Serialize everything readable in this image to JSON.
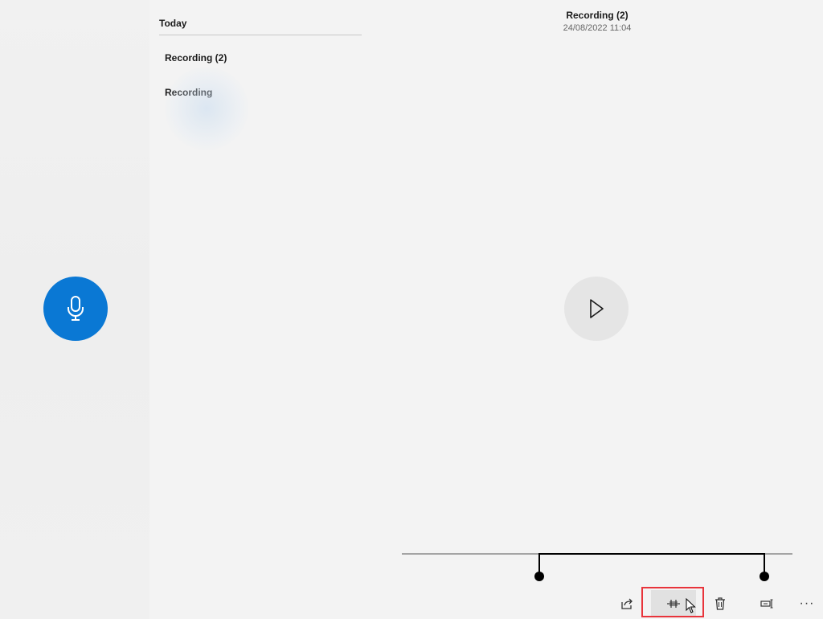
{
  "list": {
    "group_header": "Today",
    "items": [
      {
        "label": "Recording (2)"
      },
      {
        "label": "Recording"
      }
    ]
  },
  "detail": {
    "title": "Recording (2)",
    "date": "24/08/2022 11:04"
  },
  "toolbar": {
    "more_label": "···"
  },
  "colors": {
    "accent": "#0a78d4",
    "highlight": "#e8343b"
  },
  "icons": {
    "record": "microphone-icon",
    "play": "play-icon",
    "share": "share-icon",
    "trim": "trim-icon",
    "delete": "trash-icon",
    "rename": "rename-icon"
  }
}
